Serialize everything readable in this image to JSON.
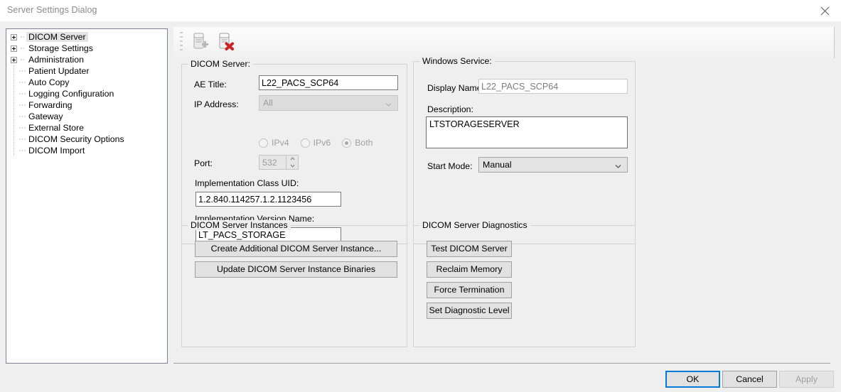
{
  "window": {
    "title": "Server Settings Dialog",
    "close_icon": "close-icon"
  },
  "tree": {
    "items": [
      {
        "label": "DICOM Server",
        "expandable": true,
        "selected": true
      },
      {
        "label": "Storage Settings",
        "expandable": true,
        "selected": false
      },
      {
        "label": "Administration",
        "expandable": true,
        "selected": false
      },
      {
        "label": "Patient Updater",
        "expandable": false,
        "selected": false
      },
      {
        "label": "Auto Copy",
        "expandable": false,
        "selected": false
      },
      {
        "label": "Logging Configuration",
        "expandable": false,
        "selected": false
      },
      {
        "label": "Forwarding",
        "expandable": false,
        "selected": false
      },
      {
        "label": "Gateway",
        "expandable": false,
        "selected": false
      },
      {
        "label": "External Store",
        "expandable": false,
        "selected": false
      },
      {
        "label": "DICOM Security Options",
        "expandable": false,
        "selected": false
      },
      {
        "label": "DICOM Import",
        "expandable": false,
        "selected": false
      }
    ]
  },
  "toolbar": {
    "add_server_icon": "add-server-icon",
    "delete_server_icon": "delete-server-icon"
  },
  "dicom_server": {
    "group_title": "DICOM Server:",
    "ae_title_label": "AE Title:",
    "ae_title_value": "L22_PACS_SCP64",
    "ip_address_label": "IP Address:",
    "ip_address_value": "All",
    "ip_version": [
      {
        "label": "IPv4",
        "checked": false
      },
      {
        "label": "IPv6",
        "checked": false
      },
      {
        "label": "Both",
        "checked": true
      }
    ],
    "port_label": "Port:",
    "port_value": "532",
    "impl_class_uid_label": "Implementation Class UID:",
    "impl_class_uid_value": "1.2.840.114257.1.2.1123456",
    "impl_version_name_label": "Implementation Version Name:",
    "impl_version_name_value": "LT_PACS_STORAGE"
  },
  "windows_service": {
    "group_title": "Windows Service:",
    "display_name_label": "Display Name:",
    "display_name_value": "L22_PACS_SCP64",
    "description_label": "Description:",
    "description_value": "LTSTORAGESERVER",
    "start_mode_label": "Start Mode:",
    "start_mode_value": "Manual"
  },
  "instances": {
    "group_title": "DICOM Server Instances",
    "create_button": "Create Additional DICOM Server Instance...",
    "update_button": "Update DICOM Server Instance Binaries"
  },
  "diagnostics": {
    "group_title": "DICOM Server Diagnostics",
    "buttons": [
      "Test DICOM Server",
      "Reclaim Memory",
      "Force Termination",
      "Set Diagnostic Level"
    ]
  },
  "footer": {
    "ok": "OK",
    "cancel": "Cancel",
    "apply": "Apply"
  },
  "colors": {
    "focus_blue": "#0078d7",
    "dialog_bg": "#efefef",
    "delete_x_red": "#cc2222"
  }
}
